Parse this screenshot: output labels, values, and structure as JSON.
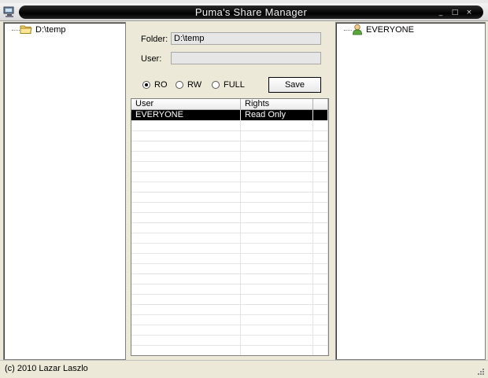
{
  "window": {
    "title": "Puma's Share Manager",
    "buttons": [
      "_",
      "□",
      "×"
    ]
  },
  "folder_tree": {
    "items": [
      {
        "label": "D:\\temp",
        "icon": "folder-icon"
      }
    ]
  },
  "form": {
    "folder_label": "Folder:",
    "folder_value": "D:\\temp",
    "user_label": "User:",
    "user_value": ""
  },
  "permissions": {
    "options": [
      {
        "label": "RO",
        "checked": true
      },
      {
        "label": "RW",
        "checked": false
      },
      {
        "label": "FULL",
        "checked": false
      }
    ],
    "save_label": "Save"
  },
  "shares_table": {
    "columns": [
      "User",
      "Rights"
    ],
    "rows": [
      {
        "user": "EVERYONE",
        "rights": "Read Only",
        "selected": true
      }
    ]
  },
  "users_tree": {
    "items": [
      {
        "label": "EVERYONE",
        "icon": "user-icon"
      }
    ]
  },
  "status": {
    "text": "(c) 2010 Lazar Laszlo"
  }
}
